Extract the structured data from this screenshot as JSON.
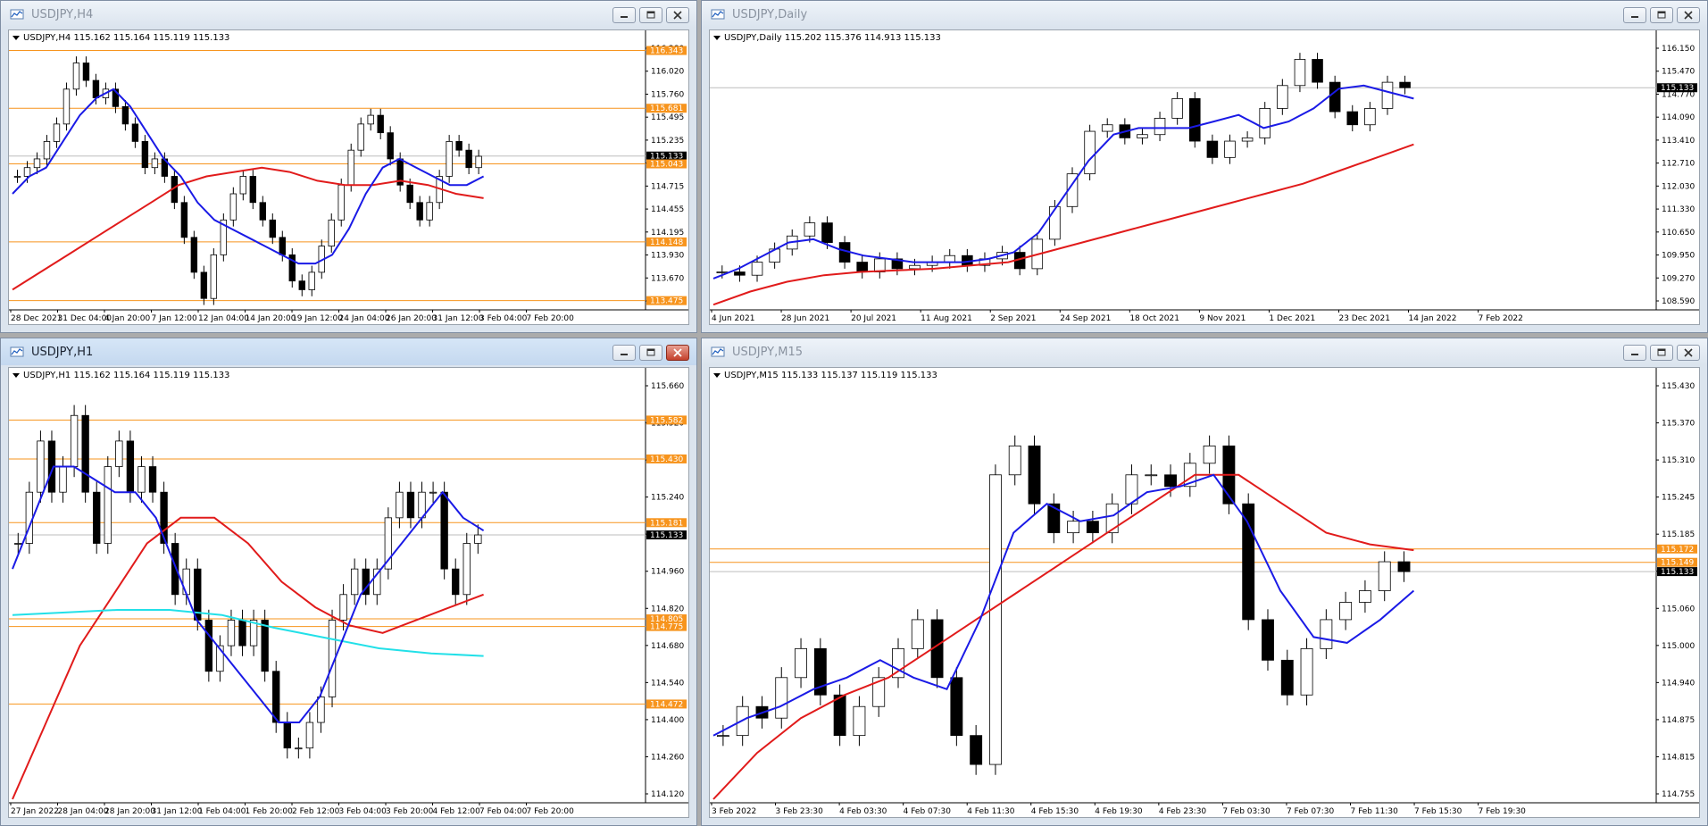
{
  "windows": [
    {
      "title": "USDJPY,H4",
      "active": false,
      "header": "USDJPY,H4  115.162 115.164 115.119 115.133",
      "chart_data": {
        "type": "line",
        "candles": [
          114.9,
          115.0,
          115.1,
          115.3,
          115.5,
          115.9,
          116.2,
          116.0,
          115.8,
          115.9,
          115.7,
          115.5,
          115.3,
          115.0,
          115.1,
          114.9,
          114.6,
          114.2,
          113.8,
          113.5,
          114.0,
          114.4,
          114.7,
          114.9,
          114.6,
          114.4,
          114.2,
          114.0,
          113.7,
          113.6,
          113.8,
          114.1,
          114.4,
          114.8,
          115.2,
          115.5,
          115.6,
          115.4,
          115.1,
          114.8,
          114.6,
          114.4,
          114.6,
          114.9,
          115.3,
          115.2,
          115.0,
          115.13
        ],
        "ma_blue": [
          114.7,
          114.9,
          115.0,
          115.3,
          115.6,
          115.8,
          115.9,
          115.7,
          115.4,
          115.1,
          114.9,
          114.6,
          114.4,
          114.3,
          114.2,
          114.1,
          114.0,
          113.9,
          113.9,
          114.0,
          114.3,
          114.7,
          115.0,
          115.1,
          115.0,
          114.9,
          114.8,
          114.8,
          114.9
        ],
        "ma_red": [
          113.6,
          113.8,
          114.0,
          114.2,
          114.4,
          114.6,
          114.8,
          114.9,
          114.95,
          115.0,
          114.95,
          114.85,
          114.8,
          114.8,
          114.85,
          114.8,
          114.7,
          114.65
        ],
        "price_labels": [
          "116.280",
          "116.020",
          "115.760",
          "115.495",
          "115.235",
          "114.975",
          "114.715",
          "114.455",
          "114.195",
          "113.930",
          "113.670",
          "113.410"
        ],
        "price_range": [
          113.41,
          116.41
        ],
        "hlines": [
          {
            "price": 116.343,
            "label": "116.343",
            "color": "#f7941d"
          },
          {
            "price": 115.681,
            "label": "115.681",
            "color": "#f7941d"
          },
          {
            "price": 115.133,
            "label": "115.133",
            "color": "#000000"
          },
          {
            "price": 115.043,
            "label": "115.043",
            "color": "#f7941d"
          },
          {
            "price": 114.148,
            "label": "114.148",
            "color": "#f7941d"
          },
          {
            "price": 113.475,
            "label": "113.475",
            "color": "#f7941d"
          }
        ],
        "time_labels": [
          "28 Dec 2021",
          "31 Dec 04:00",
          "4 Jan 20:00",
          "7 Jan 12:00",
          "12 Jan 04:00",
          "14 Jan 20:00",
          "19 Jan 12:00",
          "24 Jan 04:00",
          "26 Jan 20:00",
          "31 Jan 12:00",
          "3 Feb 04:00",
          "7 Feb 20:00"
        ]
      }
    },
    {
      "title": "USDJPY,Daily",
      "active": false,
      "header": "USDJPY,Daily  115.202 115.376 114.913 115.133",
      "chart_data": {
        "type": "line",
        "candles": [
          109.5,
          109.4,
          109.8,
          110.2,
          110.6,
          111.0,
          110.4,
          109.8,
          109.5,
          109.9,
          109.6,
          109.7,
          109.8,
          110.0,
          109.7,
          109.9,
          110.1,
          109.6,
          110.5,
          111.5,
          112.5,
          113.8,
          114.0,
          113.6,
          113.7,
          114.2,
          114.8,
          113.5,
          113.0,
          113.5,
          113.6,
          114.5,
          115.2,
          116.0,
          115.3,
          114.4,
          114.0,
          114.5,
          115.3,
          115.133
        ],
        "ma_blue": [
          109.3,
          109.6,
          110.0,
          110.4,
          110.5,
          110.2,
          110.0,
          109.9,
          109.8,
          109.8,
          109.8,
          109.9,
          110.1,
          110.7,
          111.8,
          112.9,
          113.7,
          113.9,
          113.9,
          113.9,
          114.1,
          114.3,
          113.9,
          114.1,
          114.5,
          115.1,
          115.2,
          115.0,
          114.8
        ],
        "ma_red": [
          108.5,
          108.9,
          109.2,
          109.4,
          109.5,
          109.55,
          109.6,
          109.7,
          109.8,
          110.1,
          110.4,
          110.7,
          111.0,
          111.3,
          111.6,
          111.9,
          112.2,
          112.6,
          113.0,
          113.4
        ],
        "price_labels": [
          "116.150",
          "115.470",
          "114.770",
          "114.090",
          "113.410",
          "112.710",
          "112.030",
          "111.330",
          "110.650",
          "109.950",
          "109.270",
          "108.590"
        ],
        "price_range": [
          108.45,
          116.45
        ],
        "hlines": [
          {
            "price": 115.133,
            "label": "115.133",
            "color": "#000000"
          }
        ],
        "time_labels": [
          "4 Jun 2021",
          "28 Jun 2021",
          "20 Jul 2021",
          "11 Aug 2021",
          "2 Sep 2021",
          "24 Sep 2021",
          "18 Oct 2021",
          "9 Nov 2021",
          "1 Dec 2021",
          "23 Dec 2021",
          "14 Jan 2022",
          "7 Feb 2022"
        ]
      }
    },
    {
      "title": "USDJPY,H1",
      "active": true,
      "header": "USDJPY,H1  115.162 115.164 115.119 115.133",
      "chart_data": {
        "type": "line",
        "candles": [
          115.1,
          115.3,
          115.5,
          115.3,
          115.4,
          115.6,
          115.3,
          115.1,
          115.4,
          115.5,
          115.3,
          115.4,
          115.3,
          115.1,
          114.9,
          115.0,
          114.8,
          114.6,
          114.7,
          114.8,
          114.7,
          114.8,
          114.6,
          114.4,
          114.3,
          114.3,
          114.4,
          114.5,
          114.8,
          114.9,
          115.0,
          114.9,
          115.0,
          115.2,
          115.3,
          115.2,
          115.3,
          115.3,
          115.0,
          114.9,
          115.1,
          115.133
        ],
        "ma_blue": [
          115.0,
          115.2,
          115.4,
          115.4,
          115.35,
          115.3,
          115.3,
          115.2,
          115.0,
          114.8,
          114.7,
          114.6,
          114.5,
          114.4,
          114.4,
          114.5,
          114.7,
          114.9,
          115.0,
          115.1,
          115.2,
          115.3,
          115.2,
          115.15
        ],
        "ma_red": [
          114.1,
          114.4,
          114.7,
          114.9,
          115.1,
          115.2,
          115.2,
          115.1,
          114.95,
          114.85,
          114.78,
          114.75,
          114.8,
          114.85,
          114.9
        ],
        "ma_cyan": [
          114.82,
          114.83,
          114.84,
          114.84,
          114.82,
          114.77,
          114.73,
          114.69,
          114.67,
          114.66
        ],
        "price_labels": [
          "115.660",
          "115.520",
          "115.380",
          "115.240",
          "115.100",
          "114.960",
          "114.820",
          "114.680",
          "114.540",
          "114.400",
          "114.260",
          "114.120"
        ],
        "price_range": [
          114.1,
          115.73
        ],
        "hlines": [
          {
            "price": 115.582,
            "label": "115.582",
            "color": "#f7941d"
          },
          {
            "price": 115.43,
            "label": "115.430",
            "color": "#f7941d"
          },
          {
            "price": 115.181,
            "label": "115.181",
            "color": "#f7941d"
          },
          {
            "price": 115.133,
            "label": "115.133",
            "color": "#000000"
          },
          {
            "price": 114.805,
            "label": "114.805",
            "color": "#f7941d"
          },
          {
            "price": 114.775,
            "label": "114.775",
            "color": "#f7941d"
          },
          {
            "price": 114.472,
            "label": "114.472",
            "color": "#f7941d"
          }
        ],
        "time_labels": [
          "27 Jan 2022",
          "28 Jan 04:00",
          "28 Jan 20:00",
          "31 Jan 12:00",
          "1 Feb 04:00",
          "1 Feb 20:00",
          "2 Feb 12:00",
          "3 Feb 04:00",
          "3 Feb 20:00",
          "4 Feb 12:00",
          "7 Feb 04:00",
          "7 Feb 20:00"
        ]
      }
    },
    {
      "title": "USDJPY,M15",
      "active": false,
      "header": "USDJPY,M15  115.133 115.137 115.119 115.133",
      "chart_data": {
        "type": "line",
        "candles": [
          114.85,
          114.9,
          114.88,
          114.95,
          115.0,
          114.92,
          114.85,
          114.9,
          114.95,
          115.0,
          115.05,
          114.95,
          114.85,
          114.8,
          115.3,
          115.35,
          115.25,
          115.2,
          115.22,
          115.2,
          115.25,
          115.3,
          115.3,
          115.28,
          115.32,
          115.35,
          115.25,
          115.05,
          114.98,
          114.92,
          115.0,
          115.05,
          115.08,
          115.1,
          115.15,
          115.133
        ],
        "ma_blue": [
          114.85,
          114.88,
          114.9,
          114.93,
          114.95,
          114.98,
          114.95,
          114.93,
          115.05,
          115.2,
          115.25,
          115.22,
          115.23,
          115.27,
          115.28,
          115.3,
          115.22,
          115.1,
          115.02,
          115.01,
          115.05,
          115.1
        ],
        "ma_red": [
          114.74,
          114.82,
          114.88,
          114.92,
          114.95,
          115.0,
          115.05,
          115.1,
          115.15,
          115.2,
          115.25,
          115.3,
          115.3,
          115.25,
          115.2,
          115.18,
          115.17
        ],
        "price_labels": [
          "115.430",
          "115.370",
          "115.310",
          "115.245",
          "115.185",
          "115.120",
          "115.060",
          "115.000",
          "114.940",
          "114.875",
          "114.815",
          "114.755"
        ],
        "price_range": [
          114.74,
          115.46
        ],
        "hlines": [
          {
            "price": 115.172,
            "label": "115.172",
            "color": "#f7941d"
          },
          {
            "price": 115.149,
            "label": "115.149",
            "color": "#f7941d"
          },
          {
            "price": 115.133,
            "label": "115.133",
            "color": "#000000"
          }
        ],
        "time_labels": [
          "3 Feb 2022",
          "3 Feb 23:30",
          "4 Feb 03:30",
          "4 Feb 07:30",
          "4 Feb 11:30",
          "4 Feb 15:30",
          "4 Feb 19:30",
          "4 Feb 23:30",
          "7 Feb 03:30",
          "7 Feb 07:30",
          "7 Feb 11:30",
          "7 Feb 15:30",
          "7 Feb 19:30"
        ]
      }
    }
  ],
  "colors": {
    "ma_blue": "#1a1ae6",
    "ma_red": "#e11b1b",
    "ma_cyan": "#22e0e8",
    "level": "#f7941d",
    "candle": "#000000",
    "current_price": "#000000"
  }
}
